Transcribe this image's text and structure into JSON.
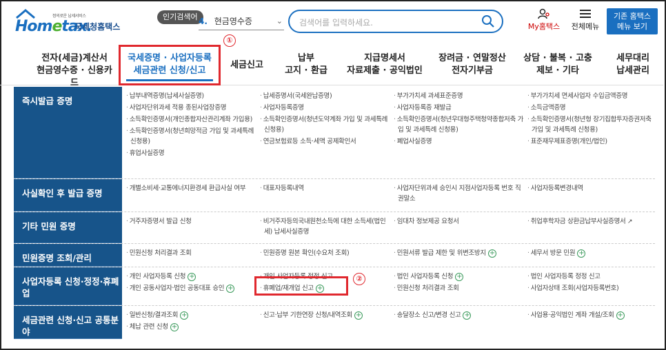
{
  "header": {
    "logo_small": "정의로운 납세서비스",
    "logo_main": "Hometax",
    "logo_sub": "국세청홈택스",
    "popular_badge": "인기검색어",
    "popular_number": "4.",
    "popular_term": "현금영수증",
    "search_placeholder": "검색어를 입력하세요.",
    "my_hometax": "My홈택스",
    "full_menu": "전체메뉴",
    "old_hometax_line1": "기존 홈택스",
    "old_hometax_line2": "메뉴 보기"
  },
  "nav": [
    {
      "l1": "전자(세금)계산서",
      "l2": "현금영수증 · 신용카드"
    },
    {
      "l1": "국세증명 · 사업자등록",
      "l2": "세금관련 신청/신고"
    },
    {
      "l1": "세금신고",
      "l2": ""
    },
    {
      "l1": "납부",
      "l2": "고지 · 환급"
    },
    {
      "l1": "지급명세서",
      "l2": "자료제출 · 공익법인"
    },
    {
      "l1": "장려금 · 연말정산",
      "l2": "전자기부금"
    },
    {
      "l1": "상담 · 불복 · 고충",
      "l2": "제보 · 기타"
    },
    {
      "l1": "세무대리",
      "l2": "납세관리"
    }
  ],
  "markers": {
    "one": "①",
    "two": "②"
  },
  "rows": [
    {
      "category": "즉시발급 증명",
      "cols": [
        [
          "납부내역증명(납세사실증명)",
          "사업자단위과세 적용 종된사업장증명",
          "소득확인증명서(개인종합자산관리계좌 가입용)",
          "소득확인증명서(청년희망적금 가입 및 과세특례 신청용)",
          "휴업사실증명"
        ],
        [
          "납세증명서(국세완납증명)",
          "사업자등록증명",
          "소득확인증명서(청년도약계좌 가입 및 과세특례 신청용)",
          "연금보험료등 소득·세액 공제확인서"
        ],
        [
          "부가가치세 과세표준증명",
          "사업자등록증 재발급",
          "소득확인증명서(청년우대형주택청약종합저축 가입 및 과세특례 신청용)",
          "폐업사실증명"
        ],
        [
          "부가가치세 면세사업자 수입금액증명",
          "소득금액증명",
          "소득확인증명서(청년형 장기집합투자증권저축 가입 및 과세특례 신청용)",
          "표준재무제표증명(개인/법인)"
        ]
      ]
    },
    {
      "category": "사실확인 후 발급 증명",
      "cols": [
        [
          "개별소비세·교통에너지환경세 환급사실 여부"
        ],
        [
          "대표자등록내역"
        ],
        [
          "사업자단위과세 승인시 지점사업자등록 번호 직권말소"
        ],
        [
          "사업자등록변경내역"
        ]
      ]
    },
    {
      "category": "기타 민원 증명",
      "cols": [
        [
          "거주자증명서 발급 신청"
        ],
        [
          "비거주자등의국내원천소득에 대한 소득세(법인세) 납세사실증명"
        ],
        [
          "임대차 정보제공 요청서"
        ],
        [
          "취업후학자금 상환금납부사실증명서"
        ]
      ]
    },
    {
      "category": "민원증명 조회/관리",
      "cols": [
        [
          "민원신청 처리결과 조회"
        ],
        [
          "민원증명 원본 확인(수요처 조회)"
        ],
        [
          "민원서류 발급 제한 및 위변조방지"
        ],
        [
          "세무서 방문 민원"
        ]
      ]
    },
    {
      "category": "사업자등록 신청·정정·휴폐업",
      "cols": [
        [
          "개인 사업자등록 신청",
          "개인 공동사업자·법인 공동대표 승인"
        ],
        [
          "개인 사업자등록 정정 신고",
          "휴폐업/재개업 신고"
        ],
        [
          "법인 사업자등록 신청",
          "민원신청 처리결과 조회"
        ],
        [
          "법인 사업자등록 정정 신고",
          "사업자상태 조회(사업자등록번호)"
        ]
      ]
    },
    {
      "category": "세금관련 신청·신고 공통분야",
      "cols": [
        [
          "일반신청/결과조회",
          "체납 관련 신청"
        ],
        [
          "신고·납부 기한연장 신청/내역조회"
        ],
        [
          "송달장소 신고/변경 신고"
        ],
        [
          "사업용·공익법인 계좌 개설/조회"
        ]
      ]
    }
  ]
}
